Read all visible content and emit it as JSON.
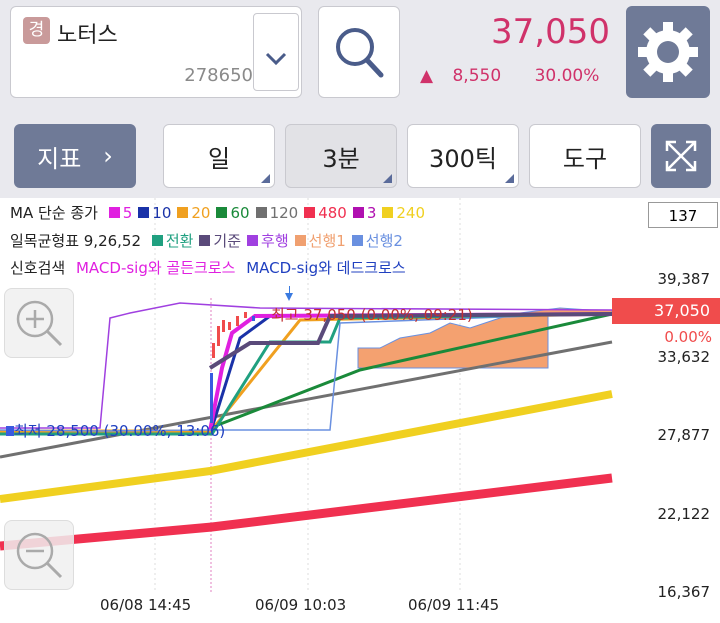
{
  "stock": {
    "badge": "경",
    "name": "노터스",
    "code": "278650",
    "price": "37,050",
    "change": "8,550",
    "change_pct": "30.00%"
  },
  "toolbar": {
    "indicator": "지표",
    "period_day": "일",
    "period_min": "3분",
    "period_tick": "300틱",
    "tools": "도구"
  },
  "legend": {
    "ma": {
      "label": "MA 단순 종가",
      "items": [
        {
          "v": "5",
          "c": "#e020e0"
        },
        {
          "v": "10",
          "c": "#1a32a8"
        },
        {
          "v": "20",
          "c": "#f0a020"
        },
        {
          "v": "60",
          "c": "#1a8a3a"
        },
        {
          "v": "120",
          "c": "#707070"
        },
        {
          "v": "480",
          "c": "#f03050"
        },
        {
          "v": "3",
          "c": "#b010b0"
        },
        {
          "v": "240",
          "c": "#f0d020"
        }
      ]
    },
    "ichimoku": {
      "label": "일목균형표 9,26,52",
      "items": [
        {
          "v": "전환",
          "c": "#20a080"
        },
        {
          "v": "기준",
          "c": "#5a4a7a"
        },
        {
          "v": "후행",
          "c": "#a040e0"
        },
        {
          "v": "선행1",
          "c": "#f0a070"
        },
        {
          "v": "선행2",
          "c": "#6a90e0"
        }
      ]
    },
    "signal": {
      "label": "신호검색",
      "golden": "MACD-sig와 골든크로스",
      "dead": "MACD-sig와 데드크로스"
    }
  },
  "axis": {
    "count": "137",
    "y": [
      "39,387",
      "33,632",
      "27,877",
      "22,122",
      "16,367"
    ],
    "current": "37,050",
    "current_pct": "0.00%",
    "x": [
      "06/08 14:45",
      "06/09 10:03",
      "06/09 11:45"
    ]
  },
  "annotations": {
    "high": "최고 37,050 (0.00%, 09:21)",
    "low": "최저 28,500 (30.00%, 13:06)"
  }
}
